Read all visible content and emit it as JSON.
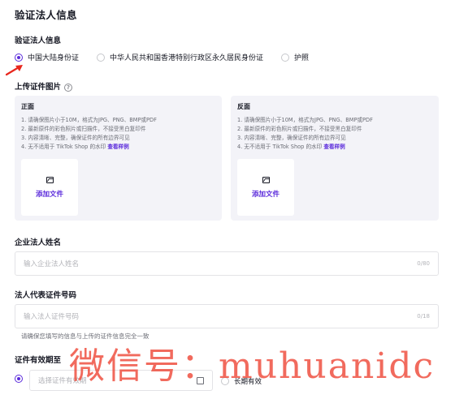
{
  "page_title": "验证法人信息",
  "verify_section": {
    "label": "验证法人信息",
    "options": [
      {
        "label": "中国大陆身份证",
        "selected": true
      },
      {
        "label": "中华人民共和国香港特别行政区永久居民身份证",
        "selected": false
      },
      {
        "label": "护照",
        "selected": false
      }
    ]
  },
  "upload_section": {
    "label": "上传证件图片",
    "help_icon": "?",
    "front": {
      "title": "正面",
      "requirements": [
        "1. 请确保图片小于10M，格式为JPG、PNG、BMP或PDF",
        "2. 最新原件的彩色照片或扫描件，不接受黑白复印件",
        "3. 内容清晰、完整，确保证件的所有边界可见"
      ],
      "req4_text": "4. 无不适用于 TikTok Shop 的水印 ",
      "sample_link": "查看样例",
      "add_label": "添加文件"
    },
    "back": {
      "title": "反面",
      "requirements": [
        "1. 请确保图片小于10M，格式为JPG、PNG、BMP或PDF",
        "2. 最新原件的彩色照片或扫描件，不接受黑白复印件",
        "3. 内容清晰、完整，确保证件的所有边界可见"
      ],
      "req4_text": "4. 无不适用于 TikTok Shop 的水印 ",
      "sample_link": "查看样例",
      "add_label": "添加文件"
    }
  },
  "name_field": {
    "label": "企业法人姓名",
    "placeholder": "输入企业法人姓名",
    "count": "0/80"
  },
  "id_field": {
    "label": "法人代表证件号码",
    "placeholder": "输入法人证件号码",
    "count": "0/18",
    "hint": "请确保您填写的信息与上传的证件信息完全一致"
  },
  "validity": {
    "label": "证件有效期至",
    "date_placeholder": "选择证件有效期",
    "long_term_label": "长期有效"
  },
  "watermark": "微信号：muhuanidc",
  "colors": {
    "accent": "#5b2bdb",
    "arrow": "#e8261c",
    "watermark": "#ef4a3a"
  }
}
